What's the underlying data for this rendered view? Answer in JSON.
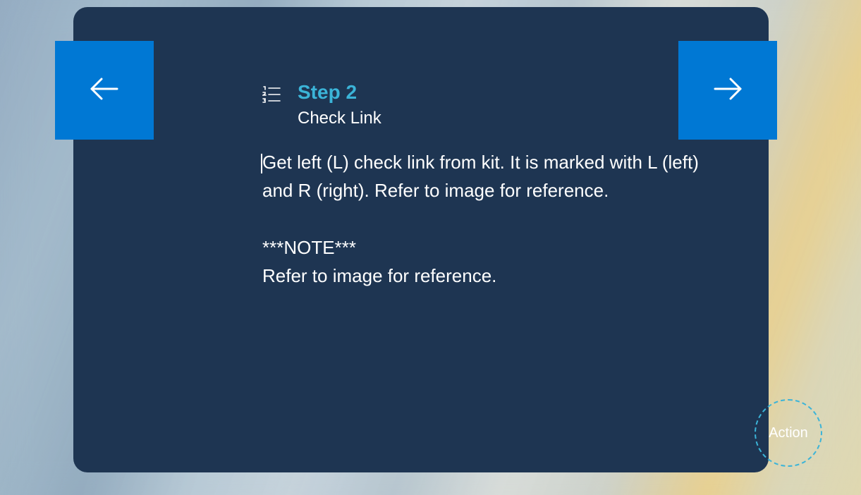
{
  "step": {
    "label": "Step 2",
    "title": "Check Link"
  },
  "body": "Get left (L) check link from kit. It is marked with L (left) and R (right). Refer to image for reference.\n\n***NOTE***\nRefer to image for reference.",
  "actionLabel": "Action"
}
